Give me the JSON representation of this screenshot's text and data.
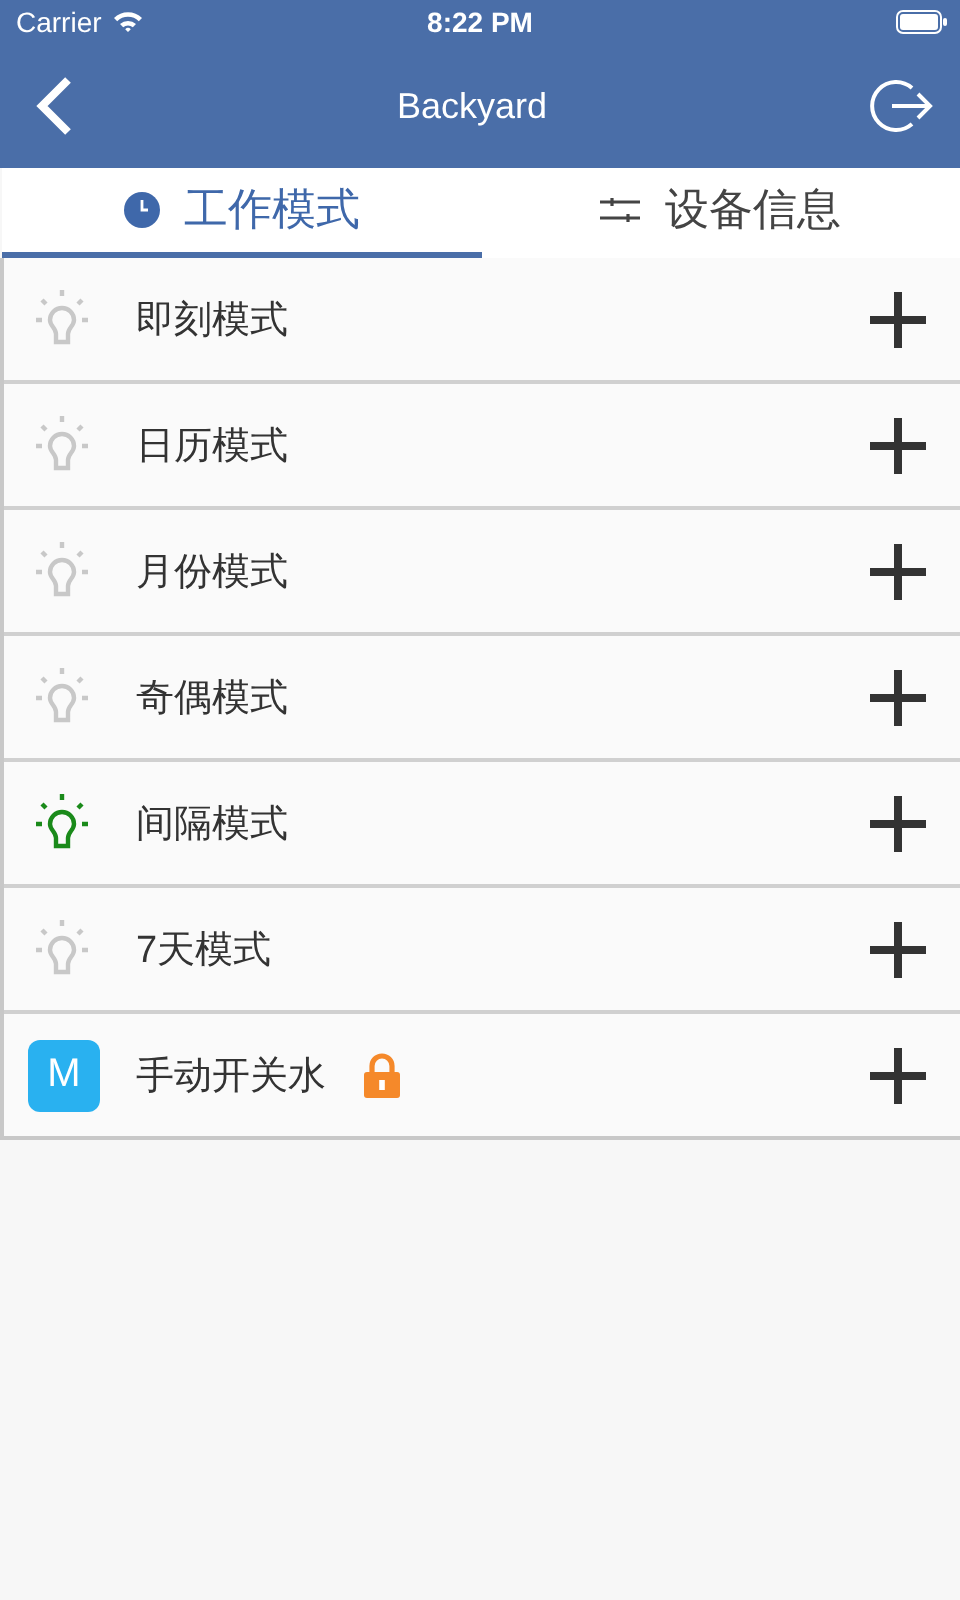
{
  "status_bar": {
    "carrier": "Carrier",
    "time": "8:22 PM"
  },
  "nav": {
    "title": "Backyard"
  },
  "tabs": [
    {
      "label": "工作模式",
      "kind": "clock",
      "selected": true
    },
    {
      "label": "设备信息",
      "kind": "sliders",
      "selected": false
    }
  ],
  "modes": [
    {
      "kind": "mode",
      "label": "即刻模式",
      "active": false
    },
    {
      "kind": "mode",
      "label": "日历模式",
      "active": false
    },
    {
      "kind": "mode",
      "label": "月份模式",
      "active": false
    },
    {
      "kind": "mode",
      "label": "奇偶模式",
      "active": false
    },
    {
      "kind": "mode",
      "label": "间隔模式",
      "active": true
    },
    {
      "kind": "mode",
      "label": "7天模式",
      "active": false
    },
    {
      "kind": "manual",
      "badge": "M",
      "label": "手动开关水",
      "locked": true
    }
  ]
}
